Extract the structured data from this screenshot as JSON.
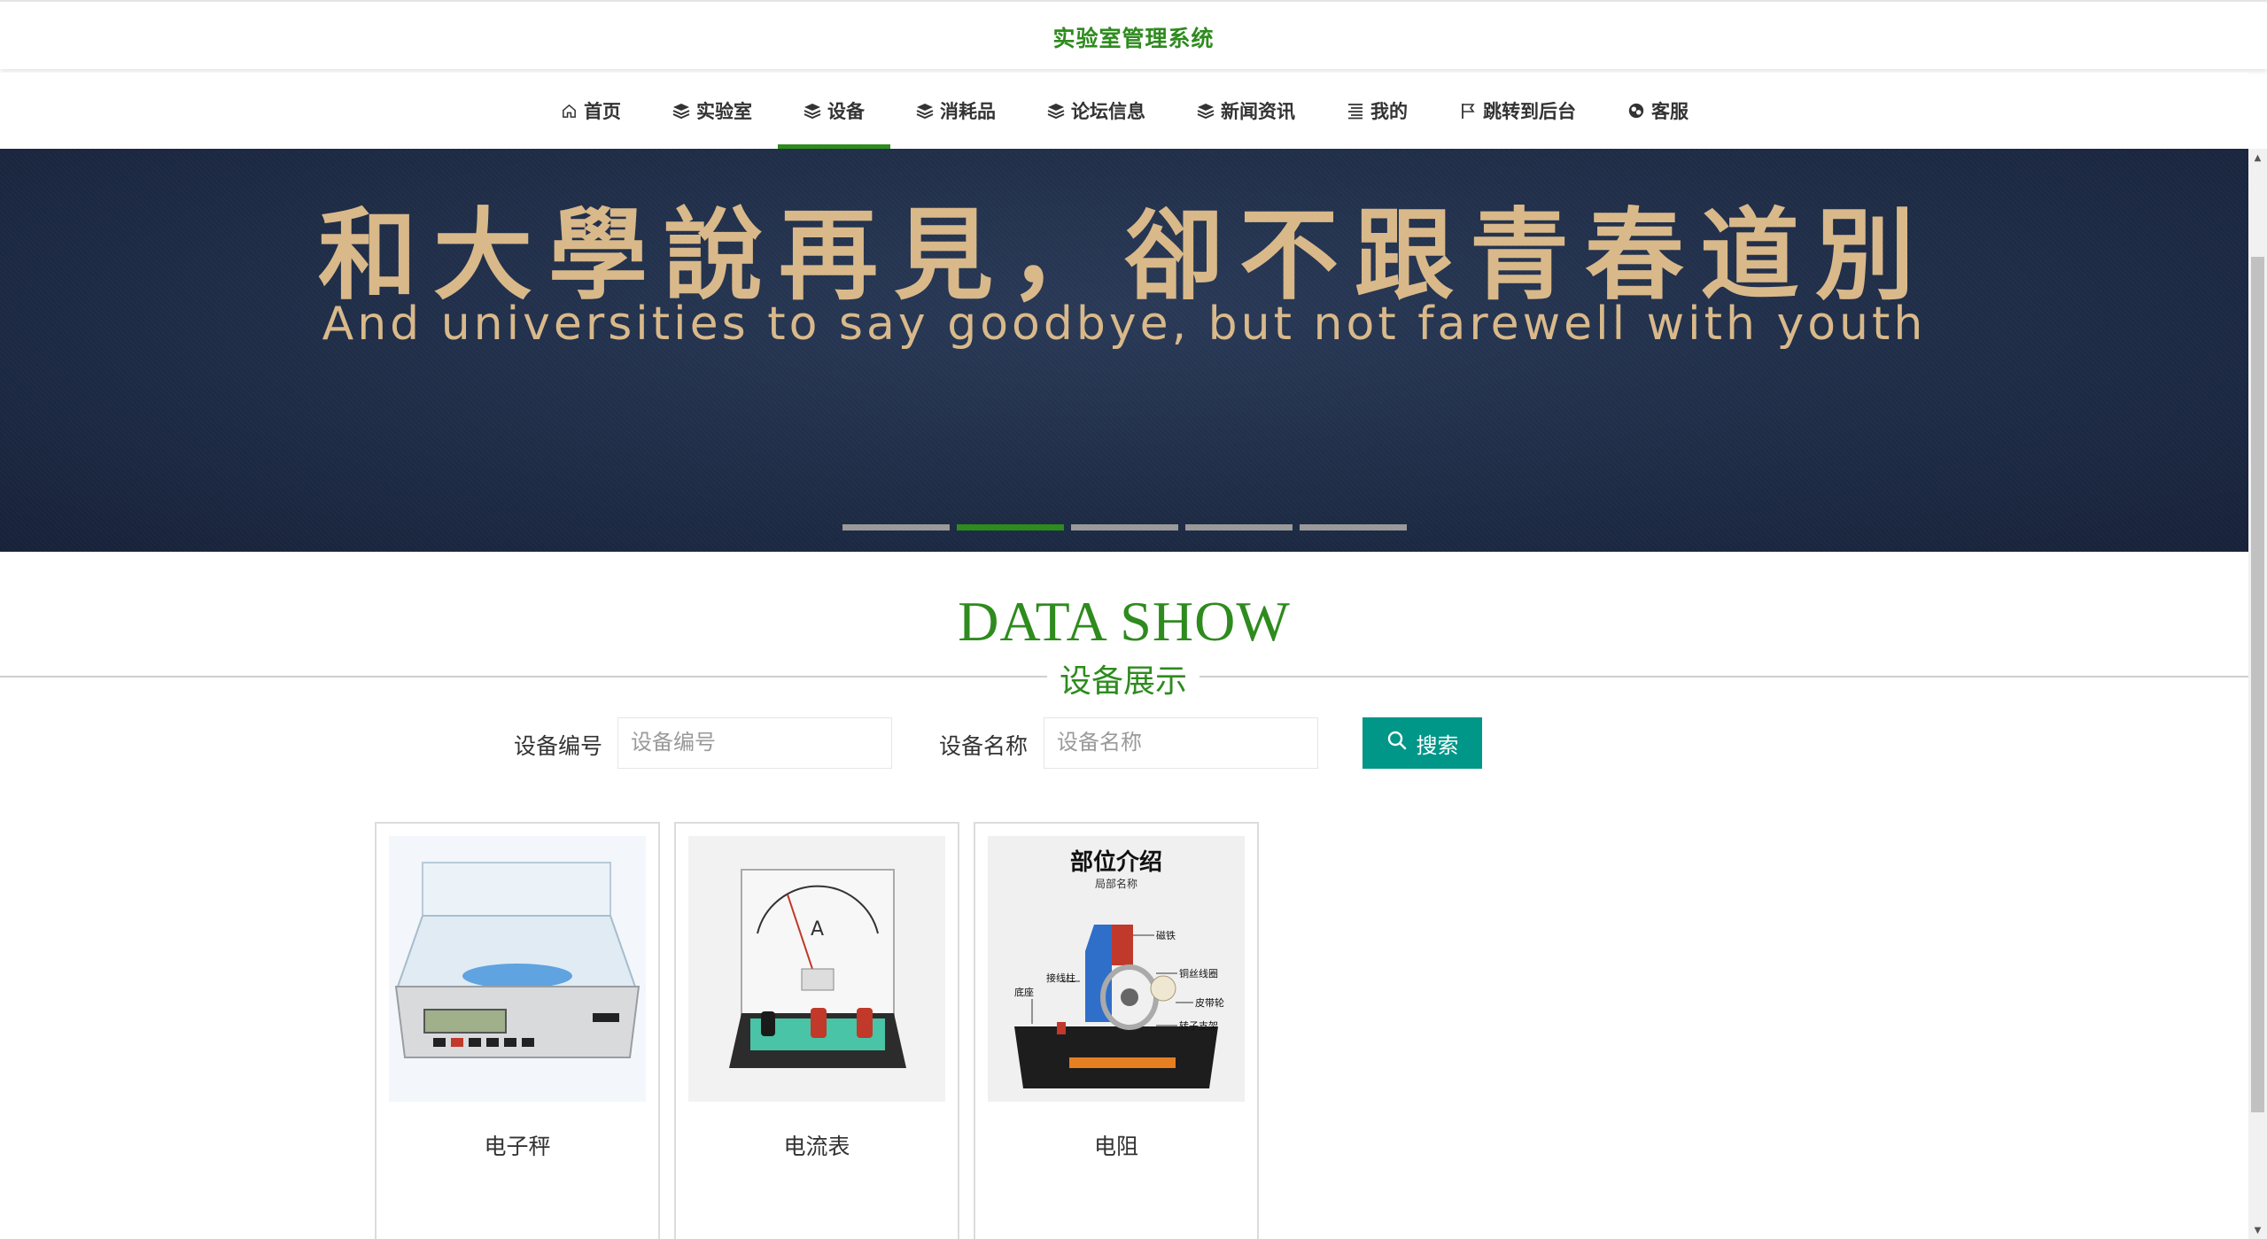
{
  "header": {
    "title": "实验室管理系统"
  },
  "nav": [
    {
      "label": "首页",
      "icon": "home-icon",
      "active": false
    },
    {
      "label": "实验室",
      "icon": "stack-icon",
      "active": false
    },
    {
      "label": "设备",
      "icon": "stack-icon",
      "active": true
    },
    {
      "label": "消耗品",
      "icon": "stack-icon",
      "active": false
    },
    {
      "label": "论坛信息",
      "icon": "stack-icon",
      "active": false
    },
    {
      "label": "新闻资讯",
      "icon": "stack-icon",
      "active": false
    },
    {
      "label": "我的",
      "icon": "list-icon",
      "active": false
    },
    {
      "label": "跳转到后台",
      "icon": "flag-icon",
      "active": false
    },
    {
      "label": "客服",
      "icon": "chat-icon",
      "active": false
    }
  ],
  "banner": {
    "text_cn": "和大學說再見，卻不跟青春道別",
    "text_en": "And universities to say goodbye, but not farewell with youth",
    "slide_count": 5,
    "active_slide": 2
  },
  "section": {
    "title_en": "DATA SHOW",
    "title_cn": "设备展示"
  },
  "search": {
    "field1_label": "设备编号",
    "field1_placeholder": "设备编号",
    "field2_label": "设备名称",
    "field2_placeholder": "设备名称",
    "button_label": "搜索"
  },
  "products": [
    {
      "name": "电子秤",
      "image": "electronic-scale-photo"
    },
    {
      "name": "电流表",
      "image": "ammeter-photo"
    },
    {
      "name": "电阻",
      "image": "motor-model-photo",
      "image_title": "部位介绍",
      "image_subtitle": "局部名称",
      "image_labels": [
        "磁铁",
        "铜丝线圈",
        "皮带轮",
        "转子支架",
        "接线柱",
        "底座"
      ]
    }
  ],
  "colors": {
    "accent": "#2e8b1e",
    "button": "#009688",
    "banner_bg": "#1f2d47",
    "banner_text": "#d9b98a"
  }
}
